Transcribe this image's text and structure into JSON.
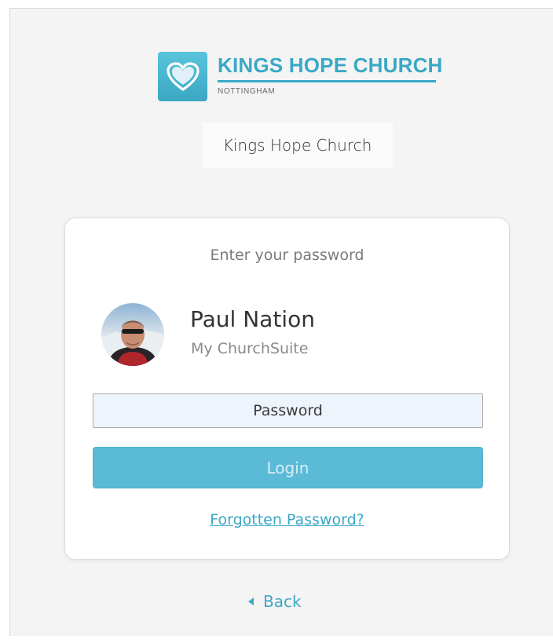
{
  "brand": {
    "title": "KINGS HOPE CHURCH",
    "subtitle": "NOTTINGHAM",
    "logo_icon": "heart-icon",
    "accent_color": "#3aa8c6"
  },
  "church_name": "Kings Hope Church",
  "card": {
    "heading": "Enter your password",
    "user": {
      "name": "Paul Nation",
      "subtitle": "My ChurchSuite"
    },
    "password": {
      "placeholder": "Password",
      "value": ""
    },
    "login_label": "Login",
    "forgot_label": "Forgotten Password?"
  },
  "back_label": "Back",
  "colors": {
    "login_button": "#5bbbd7",
    "link": "#3aa8c6",
    "page_background": "#f4f4f4"
  }
}
